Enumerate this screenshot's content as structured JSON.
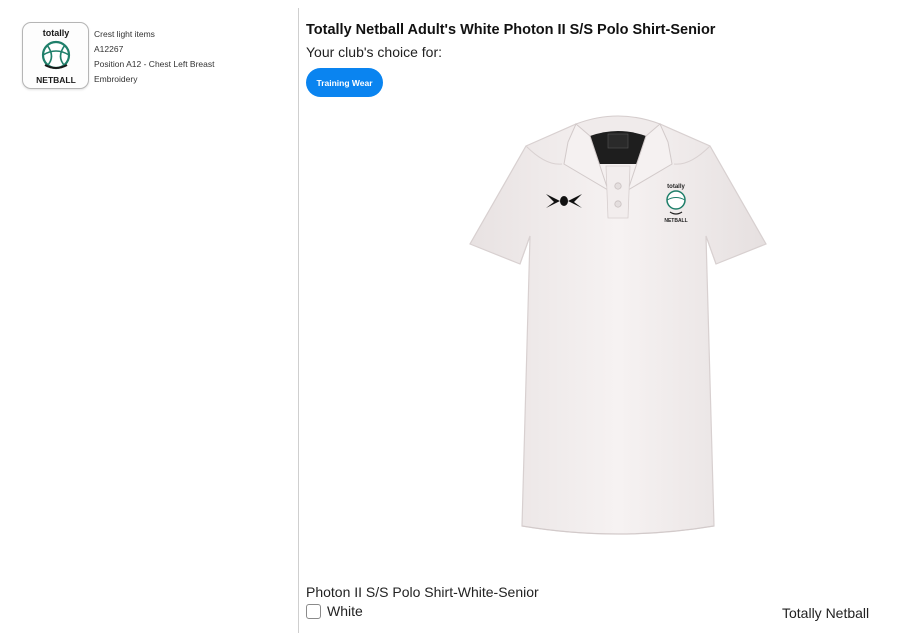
{
  "crest": {
    "logo_text_top": "totally",
    "logo_text_bottom": "NETBALL",
    "details": [
      "Crest light items",
      "A12267",
      "Position A12 - Chest Left Breast",
      "Embroidery"
    ]
  },
  "product": {
    "title": "Totally Netball Adult's White Photon II S/S Polo Shirt-Senior",
    "choice_label": "Your club's choice for:",
    "category_button": "Training Wear",
    "image_icon": "polo-shirt-image",
    "shirt_color": "#f3eeee"
  },
  "variant": {
    "name": "Photon II S/S Polo Shirt-White-Senior",
    "color_option": "White",
    "checked": false
  },
  "brand": "Totally Netball",
  "colors": {
    "accent": "#0a84f0",
    "logo_green": "#1f7f6a"
  }
}
